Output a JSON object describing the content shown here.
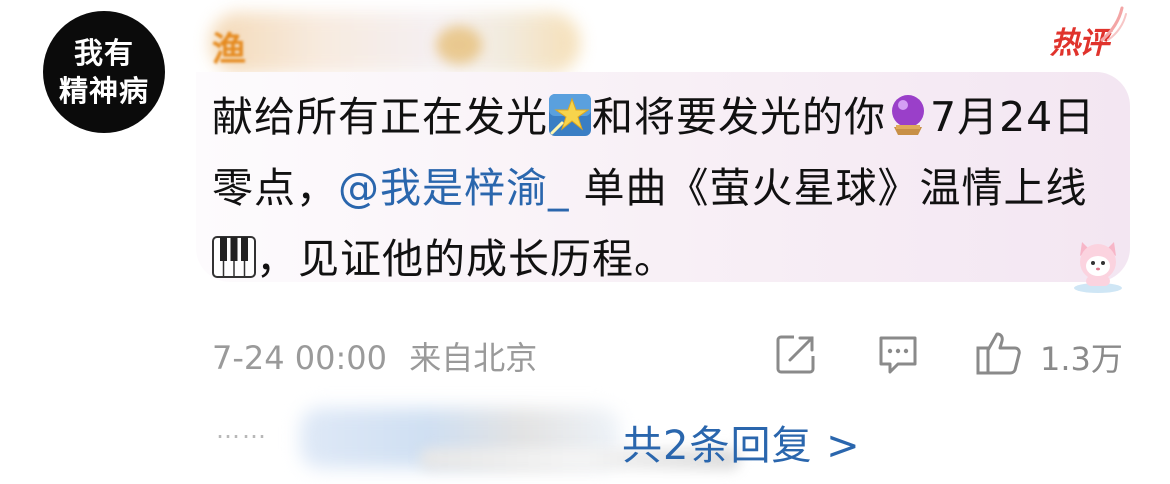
{
  "avatar": {
    "line1": "我有",
    "line2": "精神病"
  },
  "user": {
    "name_visible": "渔"
  },
  "badge": {
    "hot": "热评"
  },
  "comment": {
    "seg1": "献给所有正在发光",
    "emoji1": "star-icon",
    "seg2": "和将要发光的你",
    "emoji2": "crystal-ball-icon",
    "seg3": "7月24日零点，",
    "mention": "@我是梓渝_",
    "seg4": " 单曲《萤火星球》温情上线",
    "emoji3": "piano-keys-icon",
    "seg5": "，见证他的成长历程。"
  },
  "meta": {
    "time": "7-24 00:00",
    "location": "来自北京"
  },
  "actions": {
    "like_count": "1.3万"
  },
  "replies": {
    "dots": "……",
    "link": "共2条回复 >"
  },
  "colors": {
    "mention": "#2a66ad",
    "hot": "#e0332c",
    "name": "#e58a1f",
    "muted": "#9a9a9a"
  }
}
